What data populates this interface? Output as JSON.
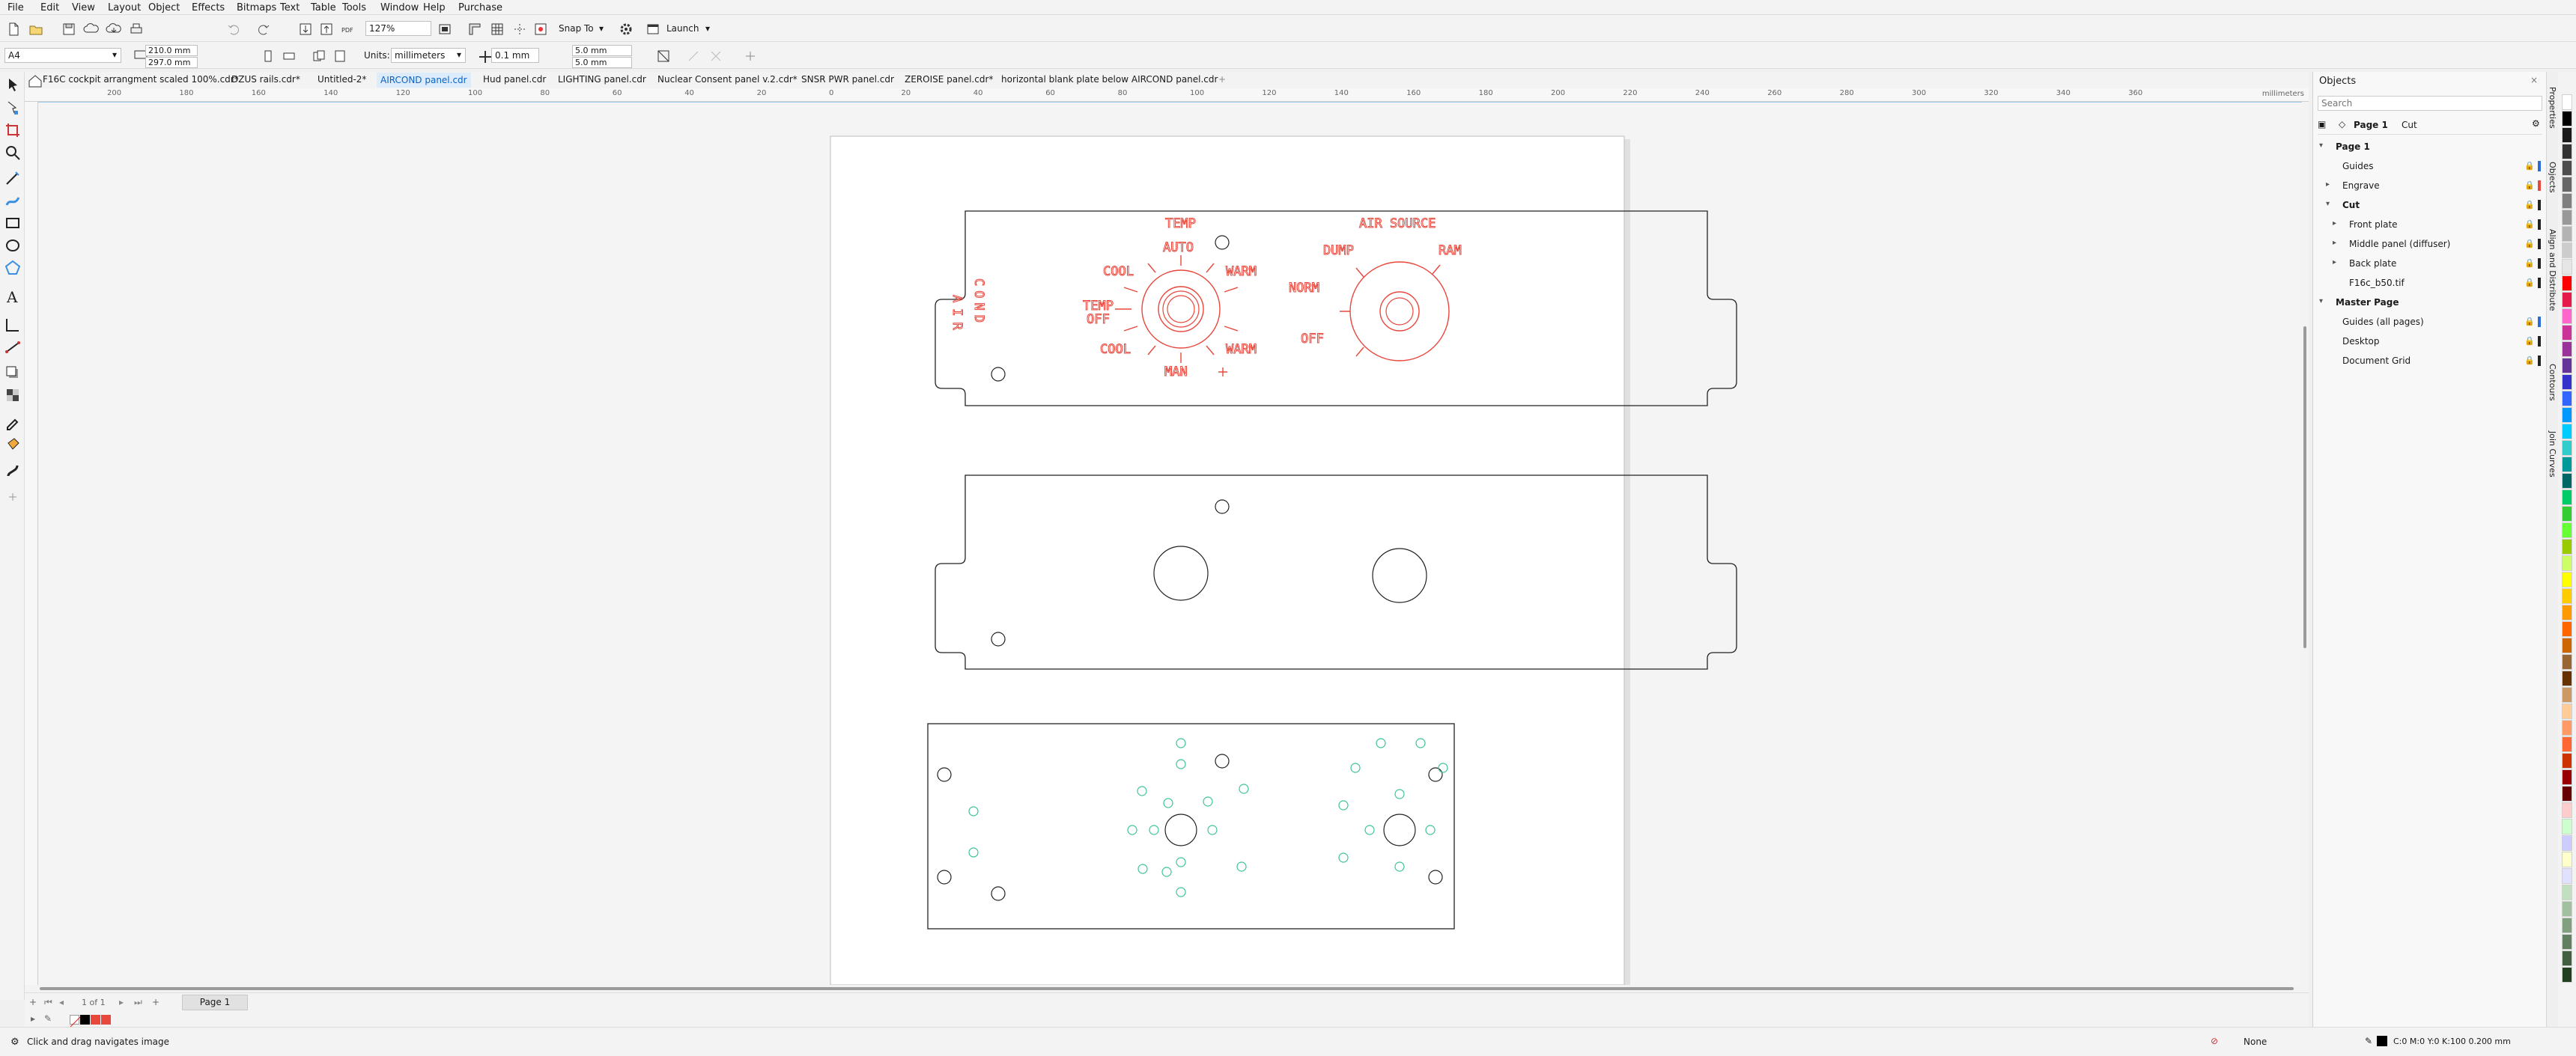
{
  "menu": [
    "File",
    "Edit",
    "View",
    "Layout",
    "Object",
    "Effects",
    "Bitmaps",
    "Text",
    "Table",
    "Tools",
    "Window",
    "Help",
    "Purchase"
  ],
  "toolbar1": {
    "zoom": "127%",
    "snap_to": "Snap To",
    "launch": "Launch"
  },
  "toolbar2": {
    "page_size": "A4",
    "width": "210.0 mm",
    "height": "297.0 mm",
    "units_label": "Units:",
    "units_value": "millimeters",
    "nudge": "0.1 mm",
    "dup_x": "5.0 mm",
    "dup_y": "5.0 mm"
  },
  "doc_tabs": [
    {
      "label": "F16C cockpit arrangment scaled 100%.cdr*",
      "active": false
    },
    {
      "label": "DZUS rails.cdr*",
      "active": false
    },
    {
      "label": "Untitled-2*",
      "active": false
    },
    {
      "label": "AIRCOND panel.cdr",
      "active": true
    },
    {
      "label": "Hud panel.cdr",
      "active": false
    },
    {
      "label": "LIGHTING panel.cdr",
      "active": false
    },
    {
      "label": "Nuclear Consent panel v.2.cdr*",
      "active": false
    },
    {
      "label": "SNSR PWR panel.cdr",
      "active": false
    },
    {
      "label": "ZEROISE panel.cdr*",
      "active": false
    },
    {
      "label": "horizontal blank plate below AIRCOND panel.cdr",
      "active": false
    }
  ],
  "ruler_units": "millimeters",
  "ruler_h_ticks": [
    "200",
    "180",
    "160",
    "140",
    "120",
    "100",
    "80",
    "60",
    "40",
    "20",
    "0",
    "20",
    "40",
    "60",
    "80",
    "100",
    "120",
    "140",
    "160",
    "180",
    "200",
    "220",
    "240",
    "260",
    "280",
    "300",
    "320",
    "340",
    "360"
  ],
  "panel_text": {
    "air": "AIR",
    "cond": "COND",
    "temp": "TEMP",
    "auto": "AUTO",
    "cool_top": "COOL",
    "warm_top": "WARM",
    "temp_off_1": "TEMP",
    "temp_off_2": "OFF",
    "cool_bottom": "COOL",
    "warm_bottom": "WARM",
    "man": "MAN",
    "air_source": "AIR SOURCE",
    "dump": "DUMP",
    "ram": "RAM",
    "norm": "NORM",
    "off": "OFF"
  },
  "page_nav": {
    "counter": "1 of 1",
    "page_tab": "Page 1"
  },
  "status": {
    "hint": "Click and drag navigates image",
    "fill_label": "None",
    "outline_info": "C:0 M:0 Y:0 K:100  0.200 mm"
  },
  "objects_panel": {
    "title": "Objects",
    "search_placeholder": "Search",
    "current_page": "Page 1",
    "current_layer": "Cut",
    "tree": [
      {
        "label": "Page 1",
        "level": 0,
        "bold": true
      },
      {
        "label": "Guides",
        "level": 1
      },
      {
        "label": "Engrave",
        "level": 1
      },
      {
        "label": "Cut",
        "level": 1,
        "bold": true
      },
      {
        "label": "Front plate",
        "level": 2
      },
      {
        "label": "Middle panel (diffuser)",
        "level": 2
      },
      {
        "label": "Back plate",
        "level": 2
      },
      {
        "label": "F16c_b50.tif",
        "level": 2
      },
      {
        "label": "Master Page",
        "level": 0,
        "bold": true
      },
      {
        "label": "Guides (all pages)",
        "level": 1
      },
      {
        "label": "Desktop",
        "level": 1
      },
      {
        "label": "Document Grid",
        "level": 1
      }
    ]
  },
  "side_tabs": [
    "Properties",
    "Objects",
    "Align and Distribute",
    "Contours",
    "Join Curves"
  ],
  "colors": {
    "engrave": "#e8473c",
    "led": "#3cc39a",
    "accent": "#0b62c4"
  },
  "palette": [
    "#ffffff",
    "#000000",
    "#1a1a1a",
    "#333333",
    "#4d4d4d",
    "#666666",
    "#808080",
    "#999999",
    "#b3b3b3",
    "#cccccc",
    "#e6e6e6",
    "#ff0000",
    "#e6194b",
    "#ff66cc",
    "#cc3399",
    "#993399",
    "#663399",
    "#3333cc",
    "#3366ff",
    "#0099ff",
    "#00ccff",
    "#33cccc",
    "#009999",
    "#006666",
    "#00cc66",
    "#33cc33",
    "#66ff33",
    "#99cc00",
    "#ccff66",
    "#ffff00",
    "#ffcc00",
    "#ff9900",
    "#ff6600",
    "#cc6600",
    "#996633",
    "#663300",
    "#cc9966",
    "#ffcc99",
    "#ff9966",
    "#ff6633",
    "#cc3300",
    "#990000",
    "#660000",
    "#ffcccc",
    "#ccffcc",
    "#ccccff",
    "#ffffcc",
    "#e0e0ff",
    "#c0e0c0",
    "#a0c0a0",
    "#80a080",
    "#608060",
    "#406040",
    "#204020"
  ]
}
